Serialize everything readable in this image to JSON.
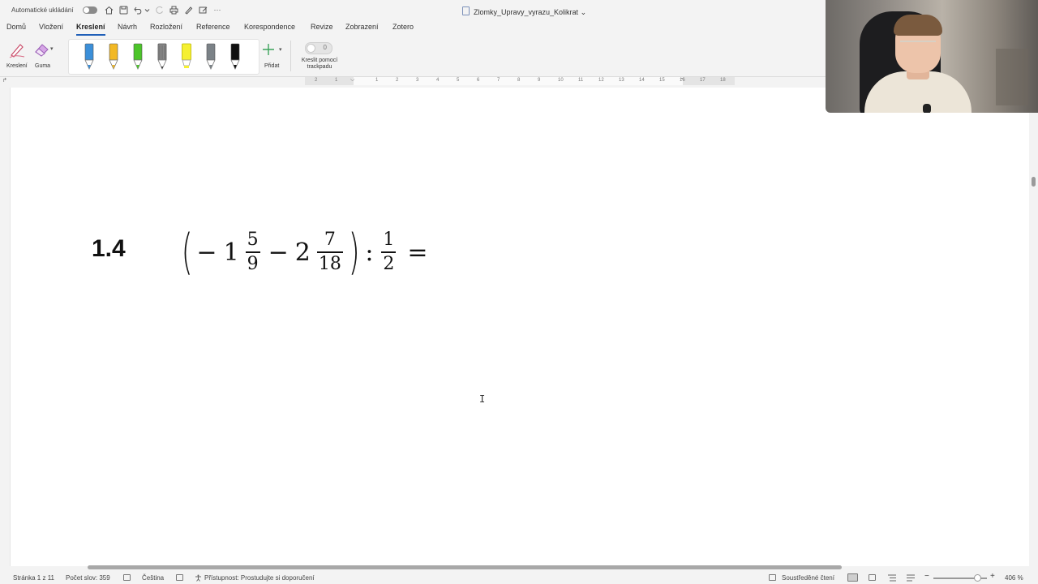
{
  "titlebar": {
    "autosave_label": "Automatické ukládání",
    "document_title": "Zlomky_Upravy_vyrazu_Kolikrat",
    "title_chevron": "⌄",
    "more": "···"
  },
  "tabs": [
    {
      "label": "Domů"
    },
    {
      "label": "Vložení"
    },
    {
      "label": "Kreslení",
      "active": true
    },
    {
      "label": "Návrh"
    },
    {
      "label": "Rozložení"
    },
    {
      "label": "Reference"
    },
    {
      "label": "Korespondence"
    },
    {
      "label": "Revize"
    },
    {
      "label": "Zobrazení"
    },
    {
      "label": "Zotero"
    }
  ],
  "ribbon": {
    "draw_label": "Kreslení",
    "eraser_label": "Guma",
    "add_label": "Přidat",
    "trackpad_label": "Kreslit pomocí trackpadu",
    "trackpad_state": "0",
    "pens": [
      {
        "kind": "pen",
        "color": "#3b8fd9"
      },
      {
        "kind": "pen",
        "color": "#f2b824"
      },
      {
        "kind": "pen",
        "color": "#4cc52a"
      },
      {
        "kind": "pencil",
        "color": "#666666"
      },
      {
        "kind": "highlighter",
        "color": "#f5f032"
      },
      {
        "kind": "pen",
        "color": "#7b8287"
      },
      {
        "kind": "pen",
        "color": "#111111"
      }
    ]
  },
  "ruler": {
    "numbers": [
      "2",
      "1",
      "1",
      "2",
      "3",
      "4",
      "5",
      "6",
      "7",
      "8",
      "9",
      "10",
      "11",
      "12",
      "13",
      "14",
      "15",
      "16",
      "17",
      "18"
    ]
  },
  "document": {
    "problem_number": "1.4",
    "equation": {
      "open_paren": "(",
      "minus1": "−",
      "whole1": "1",
      "frac1_num": "5",
      "frac1_den": "9",
      "minus2": "−",
      "whole2": "2",
      "frac2_num": "7",
      "frac2_den": "18",
      "close_paren": ")",
      "colon": ":",
      "frac3_num": "1",
      "frac3_den": "2",
      "equals": "="
    },
    "cursor": "I"
  },
  "statusbar": {
    "page": "Stránka 1 z 11",
    "word_count": "Počet slov: 359",
    "language": "Čeština",
    "accessibility": "Přístupnost: Prostudujte si doporučení",
    "focus": "Soustředěné čtení",
    "zoom": "406 %",
    "zoom_minus": "−",
    "zoom_plus": "+"
  }
}
